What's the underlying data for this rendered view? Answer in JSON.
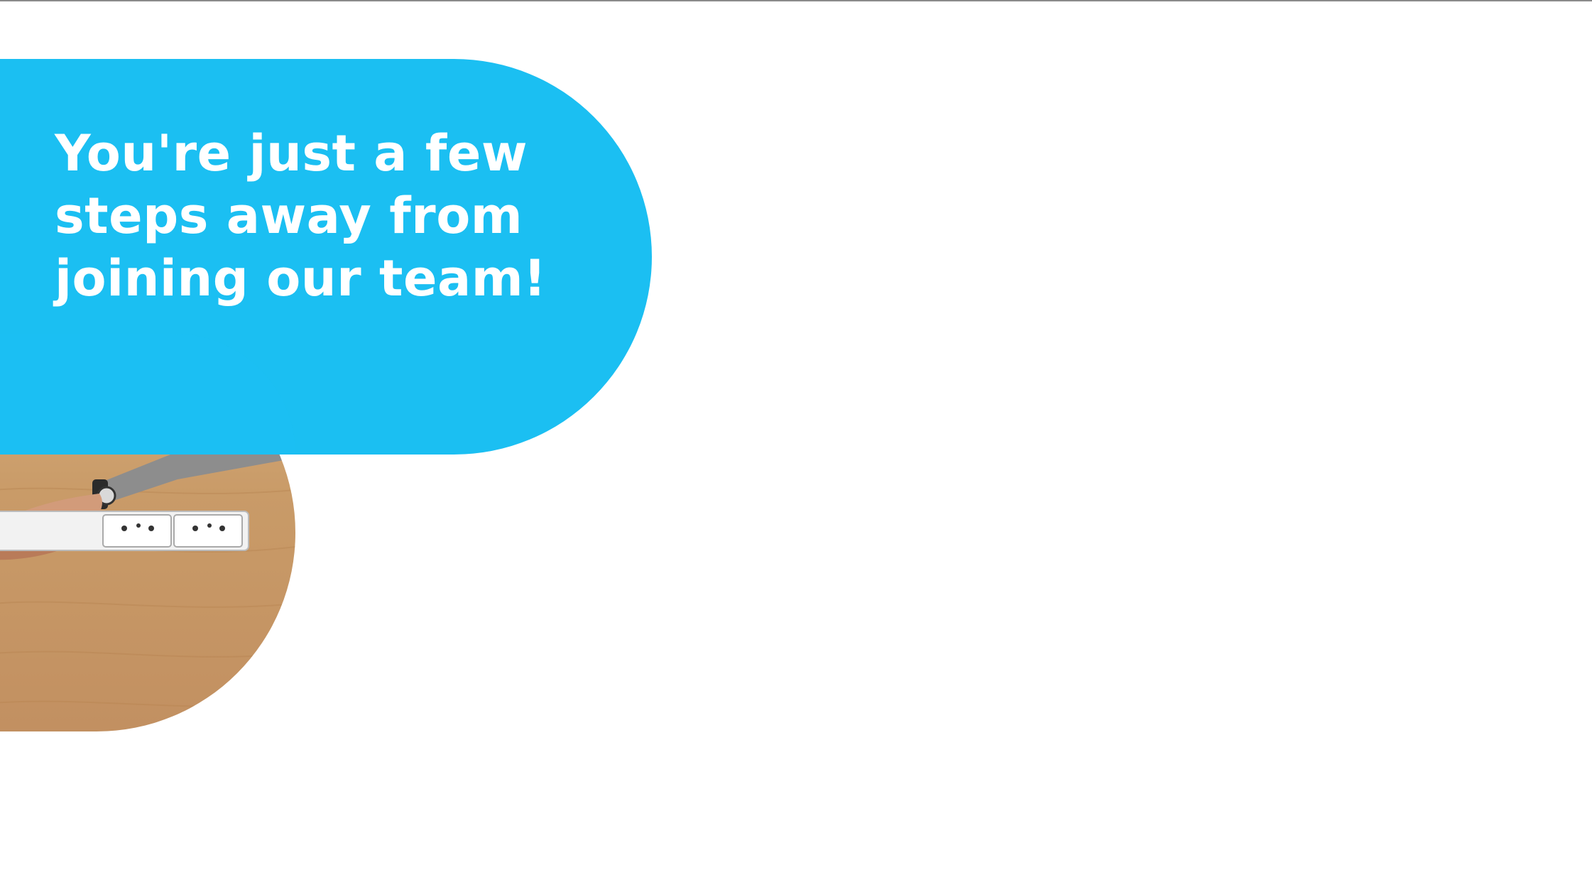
{
  "hero": {
    "headline_lines": [
      "You're just a few",
      "steps away from",
      "joining our team!"
    ],
    "pill_color": "#1bbff2",
    "text_color": "#ffffff"
  },
  "photo": {
    "subject": "handshake-over-desk-photo"
  }
}
